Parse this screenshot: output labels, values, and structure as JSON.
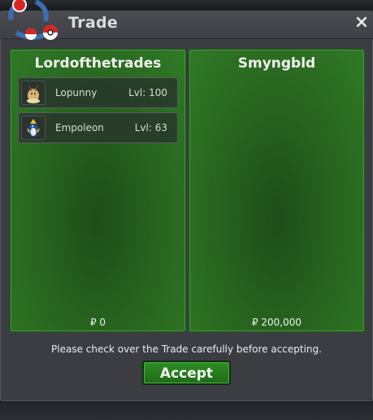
{
  "window": {
    "title": "Trade",
    "close_glyph": "×"
  },
  "left_panel": {
    "name": "Lordofthetrades",
    "pokemon": [
      {
        "name": "Lopunny",
        "level": "Lvl: 100",
        "icon": "lopunny-sprite-icon"
      },
      {
        "name": "Empoleon",
        "level": "Lvl: 63",
        "icon": "empoleon-sprite-icon"
      }
    ],
    "money": "₽ 0"
  },
  "right_panel": {
    "name": "Smyngbld",
    "pokemon": [],
    "money": "₽ 200,000"
  },
  "footer": {
    "notice": "Please check over the Trade carefully before accepting.",
    "accept_label": "Accept"
  },
  "colors": {
    "panel_green": "#2f7a25",
    "accept_green": "#2f8d25",
    "window_bg": "#3b3d42"
  }
}
